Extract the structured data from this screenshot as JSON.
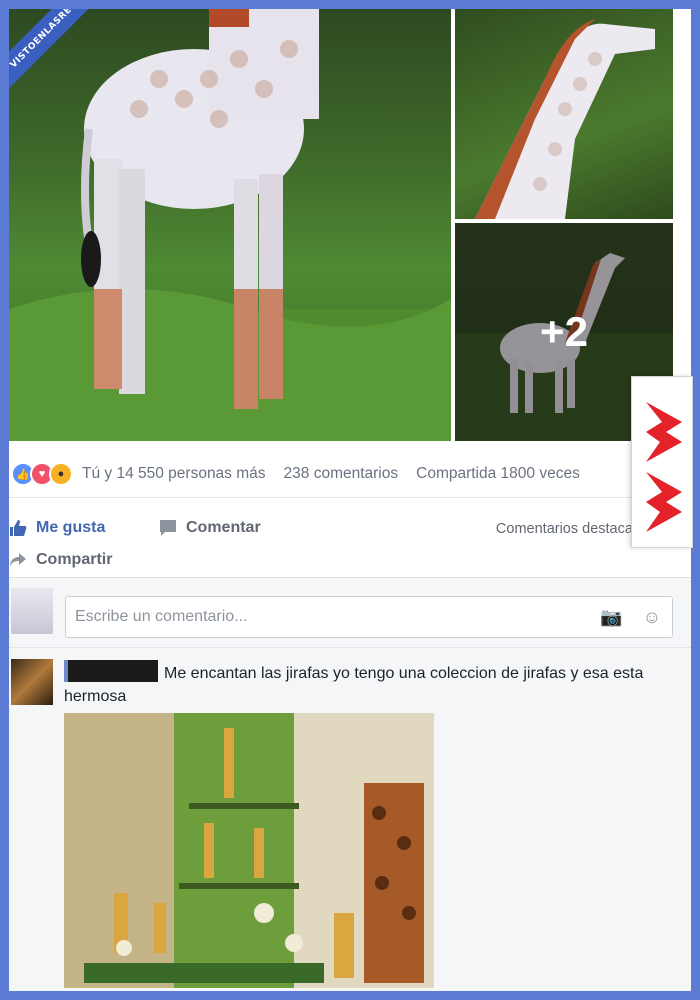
{
  "watermark": {
    "text": "VISTOENLASREDES"
  },
  "photos": {
    "more_count": "+2"
  },
  "reactions": {
    "summary": "Tú y 14 550 personas más",
    "comments": "238 comentarios",
    "shares": "Compartida 1800 veces"
  },
  "actions": {
    "like": "Me gusta",
    "comment": "Comentar",
    "share": "Compartir",
    "featured": "Comentarios destacad"
  },
  "comment_box": {
    "placeholder": "Escribe un comentario..."
  },
  "comment": {
    "text": "Me encantan las jirafas yo tengo una coleccion de jirafas y esa esta hermosa"
  },
  "colors": {
    "brand": "#4267b2",
    "frame": "#5b7bd5"
  }
}
